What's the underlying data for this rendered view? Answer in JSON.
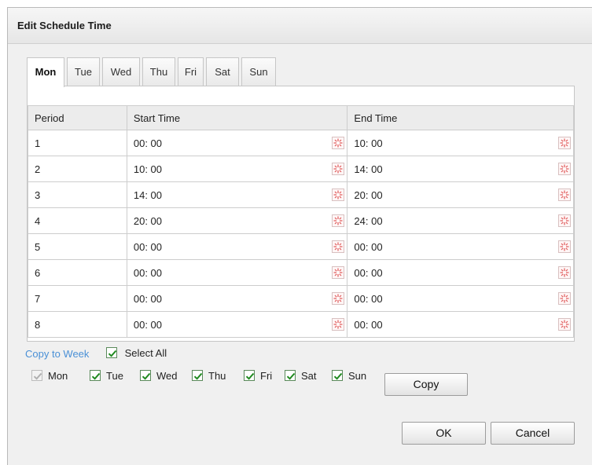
{
  "dialog": {
    "title": "Edit Schedule Time"
  },
  "tabs": [
    {
      "label": "Mon",
      "active": true
    },
    {
      "label": "Tue",
      "active": false
    },
    {
      "label": "Wed",
      "active": false
    },
    {
      "label": "Thu",
      "active": false
    },
    {
      "label": "Fri",
      "active": false
    },
    {
      "label": "Sat",
      "active": false
    },
    {
      "label": "Sun",
      "active": false
    }
  ],
  "table": {
    "headers": {
      "period": "Period",
      "start": "Start Time",
      "end": "End Time"
    },
    "rows": [
      {
        "period": "1",
        "start": "00: 00",
        "end": "10: 00"
      },
      {
        "period": "2",
        "start": "10: 00",
        "end": "14: 00"
      },
      {
        "period": "3",
        "start": "14: 00",
        "end": "20: 00"
      },
      {
        "period": "4",
        "start": "20: 00",
        "end": "24: 00"
      },
      {
        "period": "5",
        "start": "00: 00",
        "end": "00: 00"
      },
      {
        "period": "6",
        "start": "00: 00",
        "end": "00: 00"
      },
      {
        "period": "7",
        "start": "00: 00",
        "end": "00: 00"
      },
      {
        "period": "8",
        "start": "00: 00",
        "end": "00: 00"
      }
    ]
  },
  "copy": {
    "link_label": "Copy to Week",
    "select_all_label": "Select All",
    "select_all_checked": true,
    "days": [
      {
        "label": "Mon",
        "checked": true,
        "disabled": true
      },
      {
        "label": "Tue",
        "checked": true,
        "disabled": false
      },
      {
        "label": "Wed",
        "checked": true,
        "disabled": false
      },
      {
        "label": "Thu",
        "checked": true,
        "disabled": false
      },
      {
        "label": "Fri",
        "checked": true,
        "disabled": false
      },
      {
        "label": "Sat",
        "checked": true,
        "disabled": false
      },
      {
        "label": "Sun",
        "checked": true,
        "disabled": false
      }
    ],
    "copy_button": "Copy"
  },
  "footer": {
    "ok": "OK",
    "cancel": "Cancel"
  },
  "icons": {
    "time_picker": "clock-picker-icon",
    "checkbox": "checkmark-icon"
  },
  "colors": {
    "link": "#4a90d6",
    "check": "#1f8a1f"
  }
}
